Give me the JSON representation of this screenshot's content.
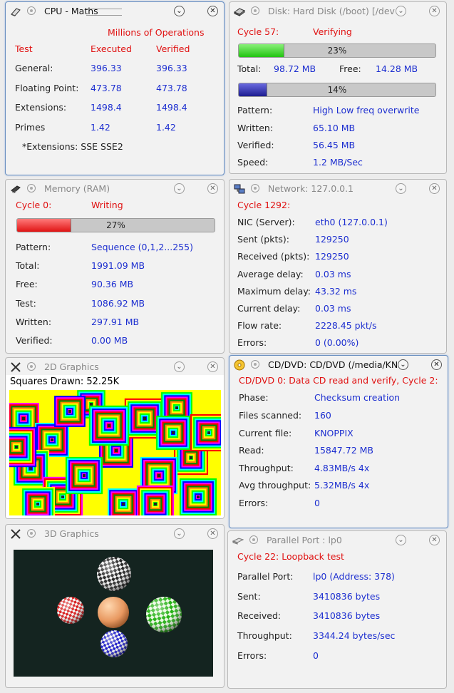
{
  "cpu": {
    "title": "CPU - Maths",
    "header": "Millions of Operations",
    "col_test": "Test",
    "col_executed": "Executed",
    "col_verified": "Verified",
    "rows": [
      {
        "name": "General:",
        "executed": "396.33",
        "verified": "396.33"
      },
      {
        "name": "Floating Point:",
        "executed": "473.78",
        "verified": "473.78"
      },
      {
        "name": "Extensions:",
        "executed": "1498.4",
        "verified": "1498.4"
      },
      {
        "name": "Primes",
        "executed": "1.42",
        "verified": "1.42"
      }
    ],
    "note": "*Extensions: SSE SSE2"
  },
  "disk": {
    "title": "Disk: Hard Disk (/boot) [/dev",
    "cycle": "Cycle 57:",
    "status": "Verifying",
    "progress1": 0.23,
    "progress1_text": "23%",
    "total_label": "Total:",
    "total_value": "98.72 MB",
    "free_label": "Free:",
    "free_value": "14.28 MB",
    "progress2": 0.14,
    "progress2_text": "14%",
    "pattern_label": "Pattern:",
    "pattern_value": "High Low freq overwrite",
    "written_label": "Written:",
    "written_value": "65.10 MB",
    "verified_label": "Verified:",
    "verified_value": "56.45 MB",
    "speed_label": "Speed:",
    "speed_value": "1.2 MB/Sec"
  },
  "memory": {
    "title": "Memory (RAM)",
    "cycle": "Cycle 0:",
    "status": "Writing",
    "progress": 0.27,
    "progress_text": "27%",
    "rows": [
      {
        "label": "Pattern:",
        "value": "Sequence (0,1,2...255)"
      },
      {
        "label": "Total:",
        "value": "1991.09 MB"
      },
      {
        "label": "Free:",
        "value": "90.36 MB"
      },
      {
        "label": "Test:",
        "value": "1086.92 MB"
      },
      {
        "label": "Written:",
        "value": "297.91 MB"
      },
      {
        "label": "Verified:",
        "value": "0.00 MB"
      }
    ]
  },
  "network": {
    "title": "Network: 127.0.0.1",
    "cycle": "Cycle 1292:",
    "rows": [
      {
        "label": "NIC (Server):",
        "value": "eth0 (127.0.0.1)"
      },
      {
        "label": "Sent (pkts):",
        "value": "129250"
      },
      {
        "label": "Received (pkts):",
        "value": "129250"
      },
      {
        "label": "Average delay:",
        "value": "0.03 ms"
      },
      {
        "label": "Maximum delay:",
        "value": "43.32 ms"
      },
      {
        "label": "Current delay:",
        "value": "0.03 ms"
      },
      {
        "label": "Flow rate:",
        "value": "2228.45 pkt/s"
      },
      {
        "label": "Errors:",
        "value": "0 (0.00%)"
      }
    ]
  },
  "graphics2d": {
    "title": "2D Graphics",
    "squares_label": "Squares Drawn: 52.25K"
  },
  "cddvd": {
    "title": "CD/DVD: CD/DVD (/media/KN",
    "status": "CD/DVD 0: Data CD read and verify, Cycle 2:",
    "rows": [
      {
        "label": "Phase:",
        "value": "Checksum creation"
      },
      {
        "label": "Files scanned:",
        "value": "160"
      },
      {
        "label": "Current file:",
        "value": "KNOPPIX"
      },
      {
        "label": "Read:",
        "value": "15847.72 MB"
      },
      {
        "label": "Throughput:",
        "value": "4.83MB/s 4x"
      },
      {
        "label": "Avg throughput:",
        "value": "5.32MB/s 4x"
      },
      {
        "label": "Errors:",
        "value": "0"
      }
    ]
  },
  "graphics3d": {
    "title": "3D Graphics"
  },
  "parallel": {
    "title": "Parallel Port : lp0",
    "status": "Cycle 22: Loopback test",
    "rows": [
      {
        "label": "Parallel Port:",
        "value": "lp0 (Address: 378)"
      },
      {
        "label": "Sent:",
        "value": "3410836 bytes"
      },
      {
        "label": "Received:",
        "value": "3410836 bytes"
      },
      {
        "label": "Throughput:",
        "value": "3344.24 bytes/sec"
      },
      {
        "label": "Errors:",
        "value": "0"
      }
    ]
  },
  "colors": {
    "value_blue": "#1d2fd0",
    "status_red": "#e01010",
    "progress_green": "#33dd22",
    "progress_blue": "#2a2aa8",
    "progress_red": "#ee2222"
  },
  "icons": [
    "book-icon",
    "hard-disk-icon",
    "memory-chip-icon",
    "network-icon",
    "tools-icon",
    "cd-icon",
    "parallel-port-icon",
    "shade-button",
    "close-button"
  ]
}
